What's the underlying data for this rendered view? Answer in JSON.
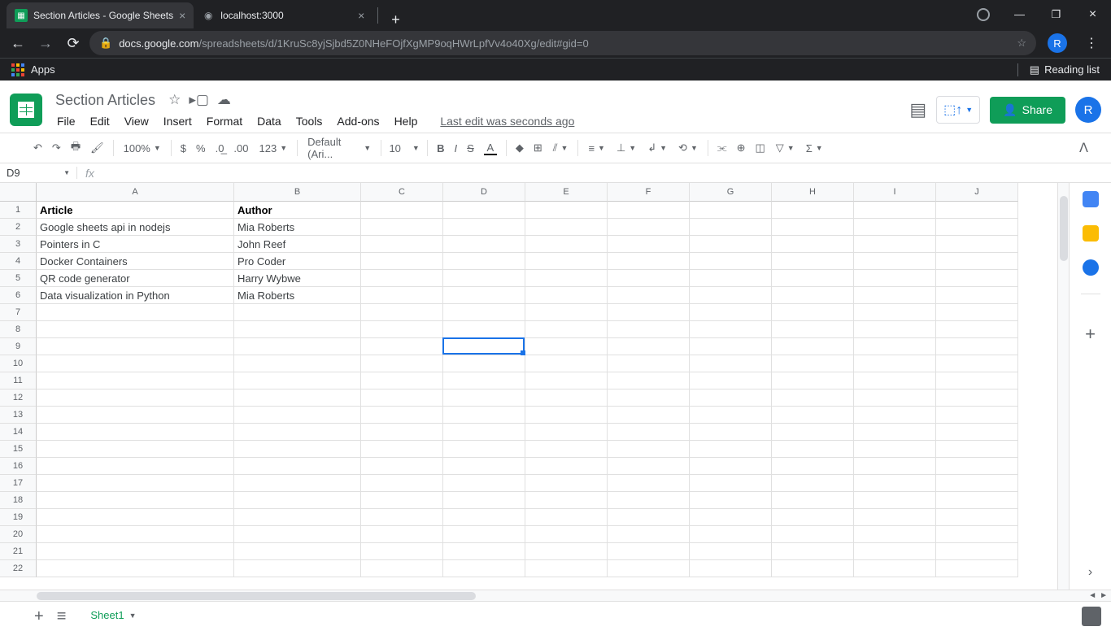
{
  "browser": {
    "tabs": [
      {
        "title": "Section Articles - Google Sheets",
        "favicon": "sheets"
      },
      {
        "title": "localhost:3000",
        "favicon": "globe"
      }
    ],
    "url_host": "docs.google.com",
    "url_path": "/spreadsheets/d/1KruSc8yjSjbd5Z0NHeFOjfXgMP9oqHWrLpfVv4o40Xg/edit#gid=0",
    "apps_label": "Apps",
    "reading_list": "Reading list",
    "avatar_letter": "R"
  },
  "sheets": {
    "title": "Section Articles",
    "menus": [
      "File",
      "Edit",
      "View",
      "Insert",
      "Format",
      "Data",
      "Tools",
      "Add-ons",
      "Help"
    ],
    "last_edit": "Last edit was seconds ago",
    "share_label": "Share",
    "avatar_letter": "R",
    "zoom": "100%",
    "font": "Default (Ari...",
    "font_size": "10",
    "format_number": "123",
    "name_box": "D9",
    "sheet_tab": "Sheet1",
    "columns": [
      "A",
      "B",
      "C",
      "D",
      "E",
      "F",
      "G",
      "H",
      "I",
      "J"
    ],
    "row_count": 22,
    "selected": {
      "row": 9,
      "col": "D"
    },
    "data": {
      "headers": [
        "Article",
        "Author"
      ],
      "rows": [
        [
          "Google sheets api in nodejs",
          "Mia Roberts"
        ],
        [
          "Pointers in C",
          "John Reef"
        ],
        [
          "Docker Containers",
          "Pro Coder"
        ],
        [
          "QR code generator",
          "Harry Wybwe"
        ],
        [
          "Data visualization in Python",
          "Mia Roberts"
        ]
      ]
    }
  }
}
